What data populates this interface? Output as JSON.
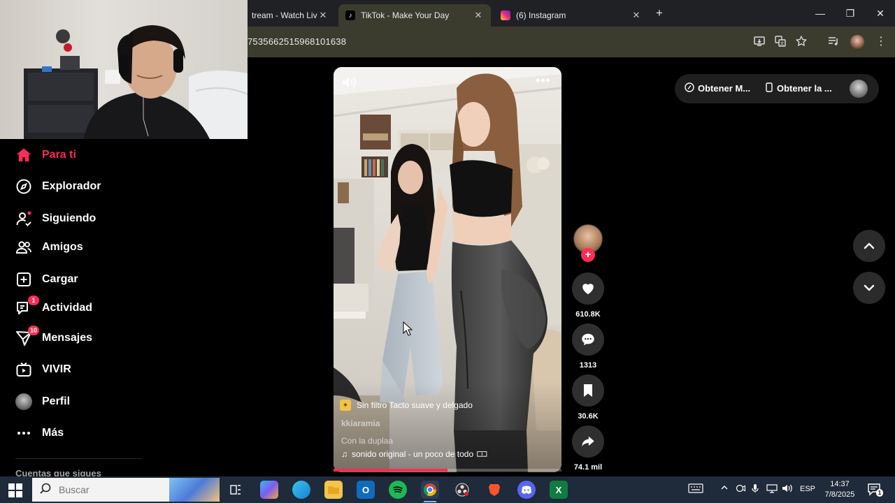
{
  "browser": {
    "tabs": [
      {
        "title": "tream - Watch Live",
        "close": "✕",
        "active": false
      },
      {
        "title": "TikTok - Make Your Day",
        "close": "✕",
        "active": true
      },
      {
        "title": "(6) Instagram",
        "close": "✕",
        "active": false
      }
    ],
    "new_tab": "+",
    "url": "7535662515968101638",
    "window_controls": {
      "minimize": "—",
      "restore": "❐",
      "close": "✕"
    }
  },
  "sidebar": {
    "items": [
      {
        "label": "Para ti",
        "icon": "home-icon",
        "active": true
      },
      {
        "label": "Explorador",
        "icon": "compass-icon"
      },
      {
        "label": "Siguiendo",
        "icon": "following-icon"
      },
      {
        "label": "Amigos",
        "icon": "friends-icon"
      },
      {
        "label": "Cargar",
        "icon": "upload-icon"
      },
      {
        "label": "Actividad",
        "icon": "activity-icon",
        "badge": "1"
      },
      {
        "label": "Mensajes",
        "icon": "messages-icon",
        "badge": "10"
      },
      {
        "label": "VIVIR",
        "icon": "live-icon"
      },
      {
        "label": "Perfil",
        "icon": "profile-avatar"
      },
      {
        "label": "Más",
        "icon": "more-icon"
      }
    ],
    "following_heading": "Cuentas que sigues"
  },
  "video": {
    "filter_label": "Sin filtro Tacto suave y delgado",
    "author": "kkiaramia",
    "description": "Con la duplaa",
    "sound": "sonido original - un poco de todo",
    "sound_suffix": "🀱",
    "progress": 0.5
  },
  "actions": {
    "likes": "610.8K",
    "comments": "1313",
    "saves": "30.6K",
    "shares": "74.1 mil"
  },
  "top_right": {
    "get_app_short": "Obtener M...",
    "get_app": "Obtener la ..."
  },
  "taskbar": {
    "search_placeholder": "Buscar",
    "language": "ESP",
    "time": "14:37",
    "date": "7/8/2025",
    "notification_count": "1"
  },
  "colors": {
    "accent": "#fe2c55",
    "tab_active_bg": "#3c3c2e",
    "tabbar_bg": "#202124",
    "taskbar_bg": "#1f2a3a"
  }
}
